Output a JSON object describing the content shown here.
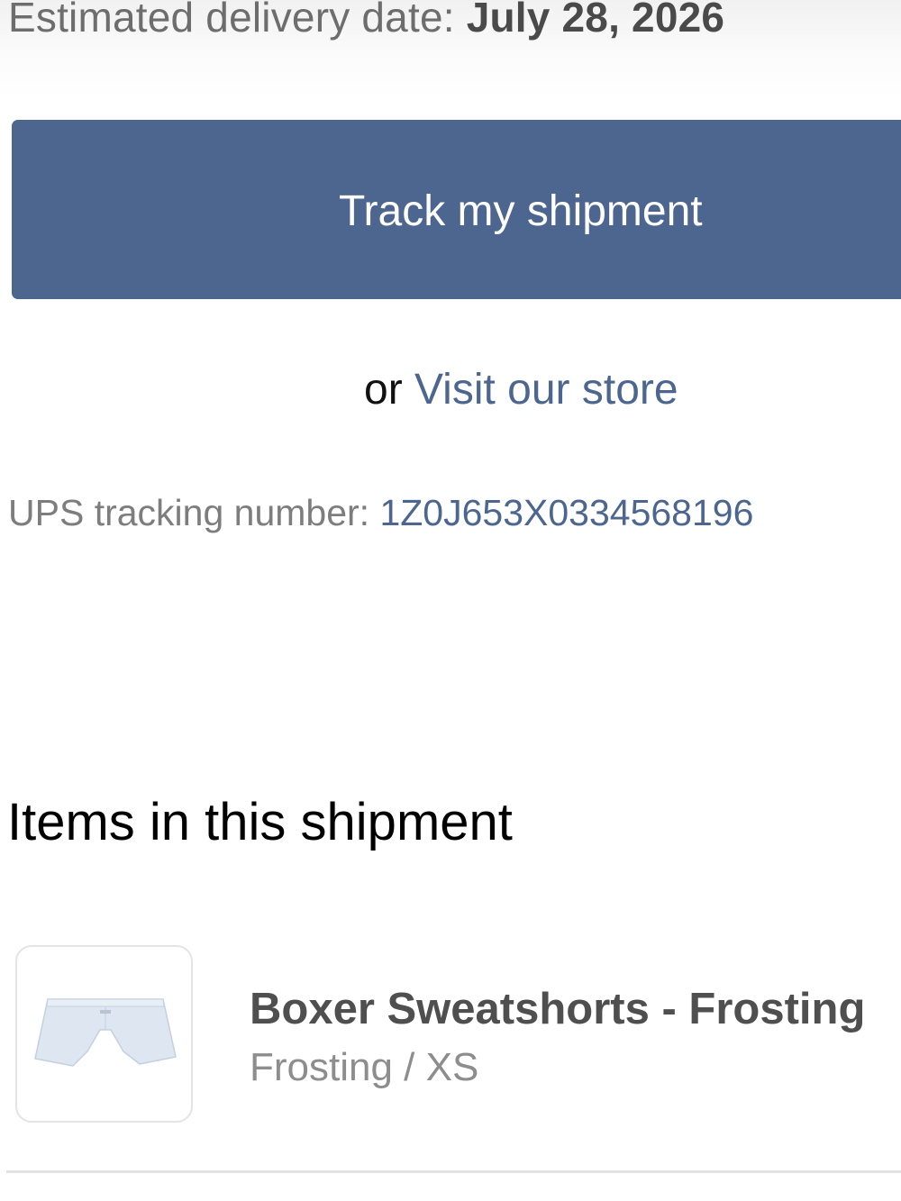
{
  "delivery": {
    "label": "Estimated delivery date: ",
    "date": "July 28, 2026"
  },
  "actions": {
    "track_label": "Track my shipment",
    "or_text": "or ",
    "visit_label": "Visit our store"
  },
  "tracking": {
    "label": "UPS tracking number: ",
    "number": "1Z0J653X0334568196"
  },
  "items_section": {
    "title": "Items in this shipment",
    "items": [
      {
        "name": "Boxer Sweatshorts - Frosting",
        "variant": "Frosting / XS",
        "thumbnail_icon": "sweatshorts-image"
      }
    ]
  },
  "colors": {
    "accent": "#4c6690",
    "text_primary": "#000000",
    "text_muted": "#7d7d7d"
  }
}
